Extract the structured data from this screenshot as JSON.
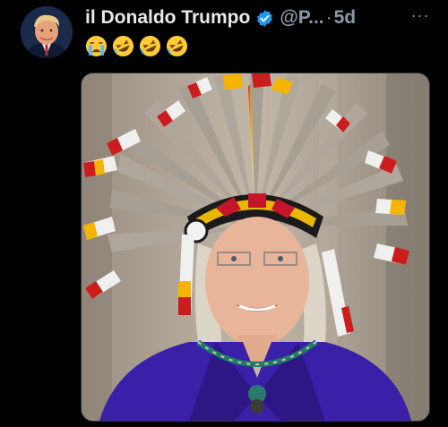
{
  "post": {
    "display_name": "il Donaldo Trumpo",
    "handle": "@P...",
    "separator": "·",
    "timestamp": "5d",
    "more_label": "···",
    "emojis": [
      "crying-face",
      "rolling-on-floor-laughing",
      "rolling-on-floor-laughing",
      "rolling-on-floor-laughing"
    ],
    "media_description_icon": "photo"
  },
  "colors": {
    "background": "#000000",
    "name": "#e7e9ea",
    "secondary": "#8b98a5",
    "verified": "#1d9bf0",
    "jacket": "#3a1fa8"
  }
}
